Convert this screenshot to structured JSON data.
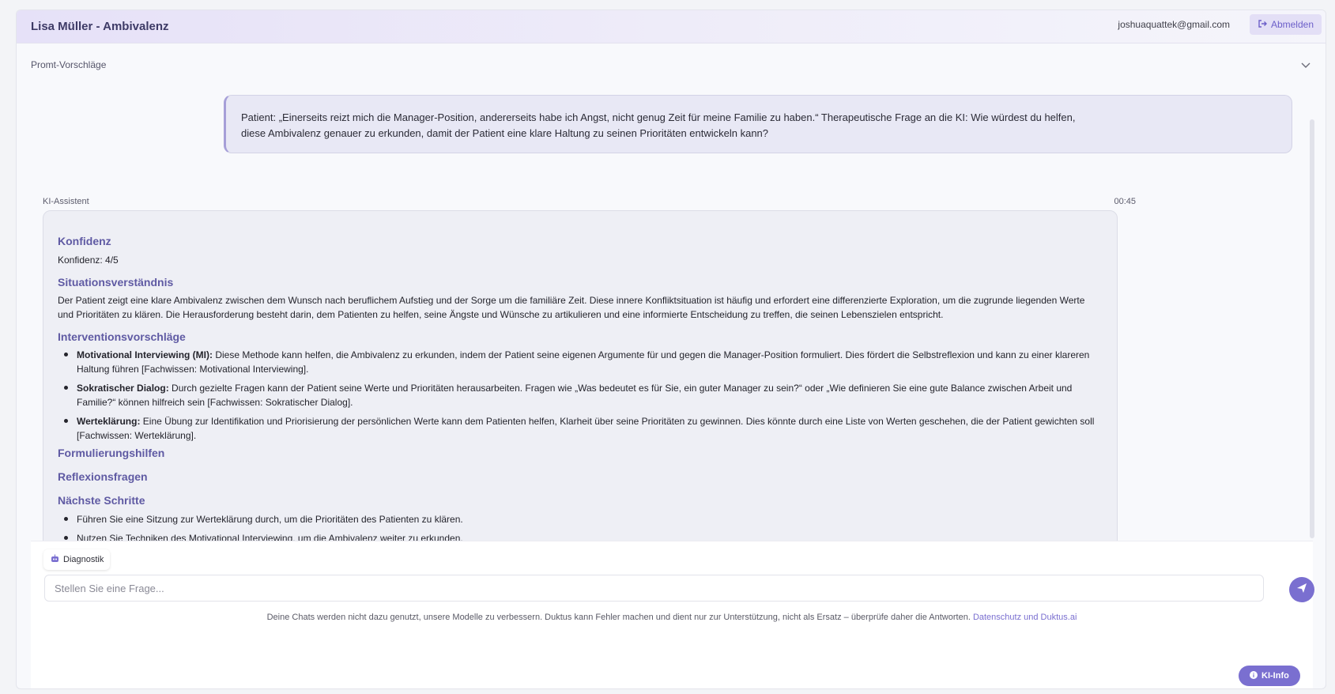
{
  "header": {
    "title": "Lisa Müller - Ambivalenz",
    "email": "joshuaquattek@gmail.com",
    "logout_label": "Abmelden"
  },
  "prompt_suggestions": {
    "label": "Promt-Vorschläge"
  },
  "user_message": {
    "line1": "Patient: „Einerseits reizt mich die Manager-Position, andererseits habe ich Angst, nicht genug Zeit für meine Familie zu haben.“ Therapeutische Frage an die KI: Wie würdest du helfen,",
    "line2": "diese Ambivalenz genauer zu erkunden, damit der Patient eine klare Haltung zu seinen Prioritäten entwickeln kann?"
  },
  "assistant": {
    "label": "KI-Assistent",
    "time": "00:45",
    "sections": {
      "konfidenz_heading": "Konfidenz",
      "konfidenz_text": "Konfidenz: 4/5",
      "situation_heading": "Situationsverständnis",
      "situation_text": "Der Patient zeigt eine klare Ambivalenz zwischen dem Wunsch nach beruflichem Aufstieg und der Sorge um die familiäre Zeit. Diese innere Konfliktsituation ist häufig und erfordert eine differenzierte Exploration, um die zugrunde liegenden Werte und Prioritäten zu klären. Die Herausforderung besteht darin, dem Patienten zu helfen, seine Ängste und Wünsche zu artikulieren und eine informierte Entscheidung zu treffen, die seinen Lebenszielen entspricht.",
      "intervention_heading": "Interventionsvorschläge",
      "interventions": [
        {
          "title": "Motivational Interviewing (MI):",
          "text": " Diese Methode kann helfen, die Ambivalenz zu erkunden, indem der Patient seine eigenen Argumente für und gegen die Manager-Position formuliert. Dies fördert die Selbstreflexion und kann zu einer klareren Haltung führen [Fachwissen: Motivational Interviewing]."
        },
        {
          "title": "Sokratischer Dialog:",
          "text": " Durch gezielte Fragen kann der Patient seine Werte und Prioritäten herausarbeiten. Fragen wie „Was bedeutet es für Sie, ein guter Manager zu sein?“ oder „Wie definieren Sie eine gute Balance zwischen Arbeit und Familie?“ können hilfreich sein [Fachwissen: Sokratischer Dialog]."
        },
        {
          "title": "Werteklärung:",
          "text": " Eine Übung zur Identifikation und Priorisierung der persönlichen Werte kann dem Patienten helfen, Klarheit über seine Prioritäten zu gewinnen. Dies könnte durch eine Liste von Werten geschehen, die der Patient gewichten soll [Fachwissen: Werteklärung]."
        }
      ],
      "formulierung_heading": "Formulierungshilfen",
      "reflexion_heading": "Reflexionsfragen",
      "next_heading": "Nächste Schritte",
      "next_steps": [
        "Führen Sie eine Sitzung zur Werteklärung durch, um die Prioritäten des Patienten zu klären.",
        "Nutzen Sie Techniken des Motivational Interviewing, um die Ambivalenz weiter zu erkunden."
      ]
    }
  },
  "composer": {
    "chip_label": "Diagnostik",
    "placeholder": "Stellen Sie eine Frage...",
    "disclaimer": "Deine Chats werden nicht dazu genutzt, unsere Modelle zu verbessern. Duktus kann Fehler machen und dient nur zur Unterstützung, nicht als Ersatz – überprüfe daher die Antworten. ",
    "disclaimer_link": "Datenschutz und Duktus.ai"
  },
  "ki_info_label": "KI-Info",
  "icons": {
    "logout": "logout-icon",
    "chevron": "chevron-down-icon",
    "chip": "robot-icon",
    "send": "send-icon",
    "info": "info-icon"
  },
  "colors": {
    "accent": "#7a6fd0",
    "heading": "#5f5aa3",
    "header_bg": "#e6e1f8"
  }
}
